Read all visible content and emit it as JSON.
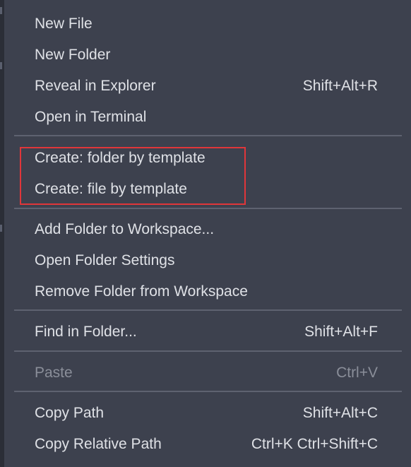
{
  "menu": {
    "groups": [
      {
        "items": [
          {
            "label": "New File",
            "shortcut": ""
          },
          {
            "label": "New Folder",
            "shortcut": ""
          },
          {
            "label": "Reveal in Explorer",
            "shortcut": "Shift+Alt+R"
          },
          {
            "label": "Open in Terminal",
            "shortcut": ""
          }
        ]
      },
      {
        "items": [
          {
            "label": "Create: folder by template",
            "shortcut": ""
          },
          {
            "label": "Create: file by template",
            "shortcut": ""
          }
        ]
      },
      {
        "items": [
          {
            "label": "Add Folder to Workspace...",
            "shortcut": ""
          },
          {
            "label": "Open Folder Settings",
            "shortcut": ""
          },
          {
            "label": "Remove Folder from Workspace",
            "shortcut": ""
          }
        ]
      },
      {
        "items": [
          {
            "label": "Find in Folder...",
            "shortcut": "Shift+Alt+F"
          }
        ]
      },
      {
        "items": [
          {
            "label": "Paste",
            "shortcut": "Ctrl+V",
            "disabled": true
          }
        ]
      },
      {
        "items": [
          {
            "label": "Copy Path",
            "shortcut": "Shift+Alt+C"
          },
          {
            "label": "Copy Relative Path",
            "shortcut": "Ctrl+K Ctrl+Shift+C"
          }
        ]
      }
    ]
  },
  "colors": {
    "menu_background": "#3d414e",
    "text": "#dfe1e6",
    "disabled_text": "#8a8e99",
    "separator": "#5e6270",
    "highlight_annotation": "#e0363a"
  }
}
